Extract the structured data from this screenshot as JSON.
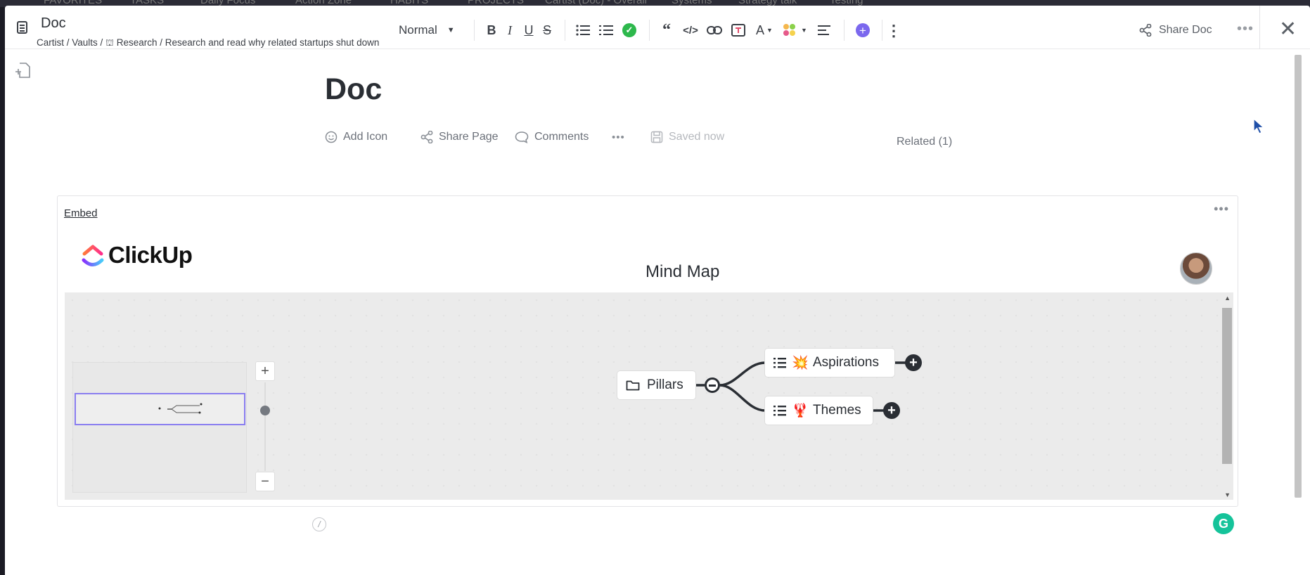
{
  "background": {
    "items": [
      "FAVORITES",
      "TASKS",
      "Daily Focus",
      "Action Zone",
      "HABITS",
      "PROJECTS",
      "Cartist (Doc) - Overall",
      "Systems",
      "Strategy talk",
      "Testing"
    ]
  },
  "header": {
    "title": "Doc",
    "breadcrumb": {
      "prefix": "Cartist / Vaults / ",
      "icon": "⛫",
      "rest": " Research / Research and read why related startups shut down"
    }
  },
  "toolbar": {
    "text_style": "Normal",
    "bold": "B",
    "italic": "I",
    "underline": "U",
    "strike": "S",
    "text_color": "A",
    "share_doc": "Share Doc"
  },
  "page": {
    "title": "Doc",
    "add_icon": "Add Icon",
    "share_page": "Share Page",
    "comments": "Comments",
    "saved": "Saved now",
    "related": "Related (1)"
  },
  "embed": {
    "label": "Embed",
    "brand": "ClickUp",
    "title": "Mind Map",
    "nodes": {
      "root": "Pillars",
      "child_1": "Aspirations",
      "child_1_emoji": "💥",
      "child_2": "Themes",
      "child_2_emoji": "🦞"
    },
    "zoom_plus": "+",
    "zoom_minus": "−"
  },
  "widgets": {
    "grammarly": "G",
    "slash": "/"
  },
  "colors": {
    "accent": "#7b68ee",
    "success": "#2db84c",
    "grammarly": "#15c39a",
    "node_line": "#2a2e34"
  }
}
